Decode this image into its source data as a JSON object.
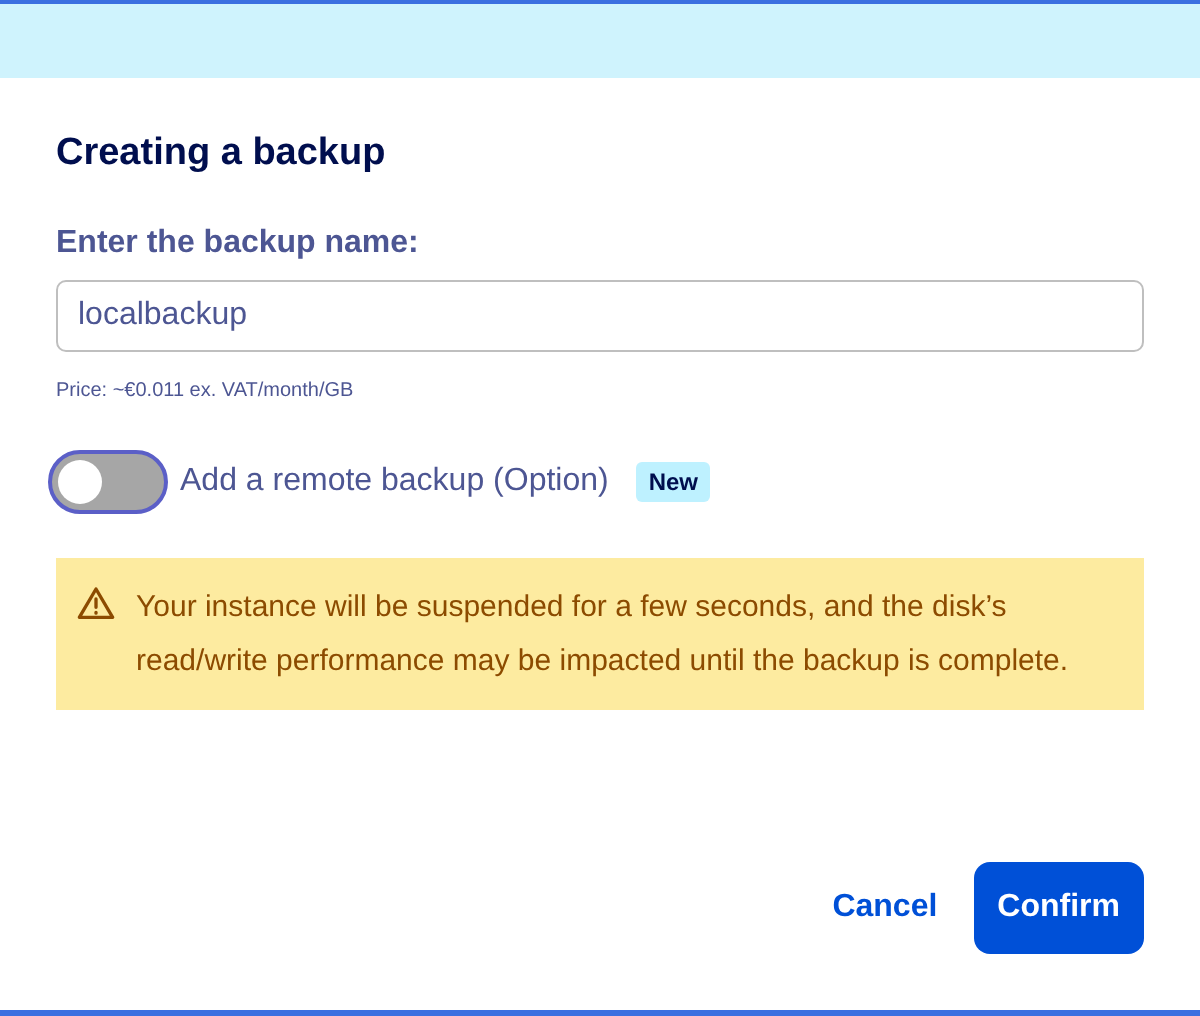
{
  "dialog": {
    "title": "Creating a backup"
  },
  "name_field": {
    "label": "Enter the backup name:",
    "value": "localbackup",
    "hint": "Price: ~€0.011 ex. VAT/month/GB"
  },
  "remote_toggle": {
    "label": "Add a remote backup (Option)",
    "on": false,
    "badge": "New"
  },
  "warning": {
    "text": "Your instance will be suspended for a few seconds, and the disk’s read/write performance may be impacted until the backup is complete."
  },
  "buttons": [
    {
      "kind": "link",
      "label": "Cancel"
    },
    {
      "kind": "primary",
      "label": "Confirm"
    }
  ]
}
